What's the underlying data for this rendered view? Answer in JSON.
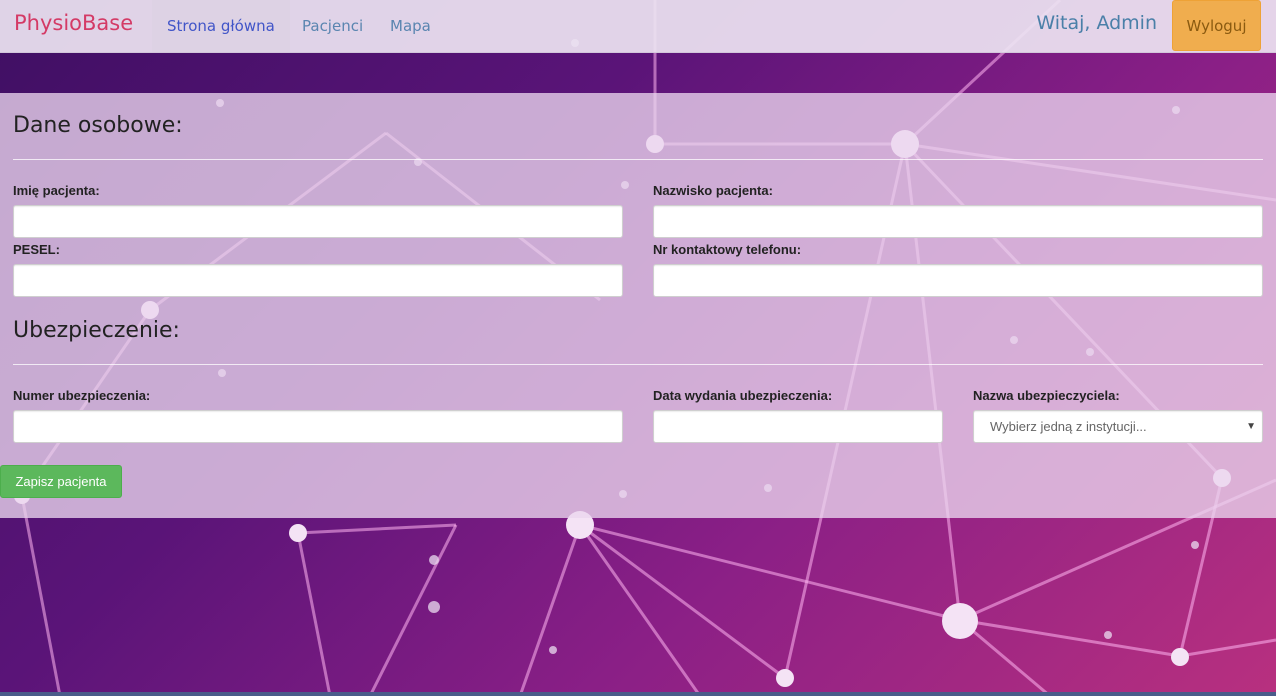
{
  "navbar": {
    "brand": "PhysioBase",
    "links": [
      "Strona główna",
      "Pacjenci",
      "Mapa"
    ],
    "active_link": "Strona główna",
    "welcome": "Witaj, Admin",
    "logout_label": "Wyloguj"
  },
  "personal": {
    "title": "Dane osobowe:",
    "first_name_label": "Imię pacjenta:",
    "last_name_label": "Nazwisko pacjenta:",
    "pesel_label": "PESEL:",
    "phone_label": "Nr kontaktowy telefonu:",
    "first_name_value": "",
    "last_name_value": "",
    "pesel_value": "",
    "phone_value": ""
  },
  "insurance": {
    "title": "Ubezpieczenie:",
    "number_label": "Numer ubezpieczenia:",
    "date_label": "Data wydania ubezpieczenia:",
    "insurer_label": "Nazwa ubezpieczyciela:",
    "insurer_selected": "Wybierz jedną z instytucji...",
    "number_value": "",
    "date_value": ""
  },
  "actions": {
    "save_label": "Zapisz pacjenta"
  },
  "colors": {
    "brand": "#d43a66",
    "link": "#5a85b0",
    "active_link": "#4155c8",
    "logout": "#f0ad4e",
    "save": "#5cb85c",
    "background_start": "#3f0f63",
    "background_end": "#b8307f"
  },
  "icons": {
    "select_caret": "chevron-down-icon"
  }
}
